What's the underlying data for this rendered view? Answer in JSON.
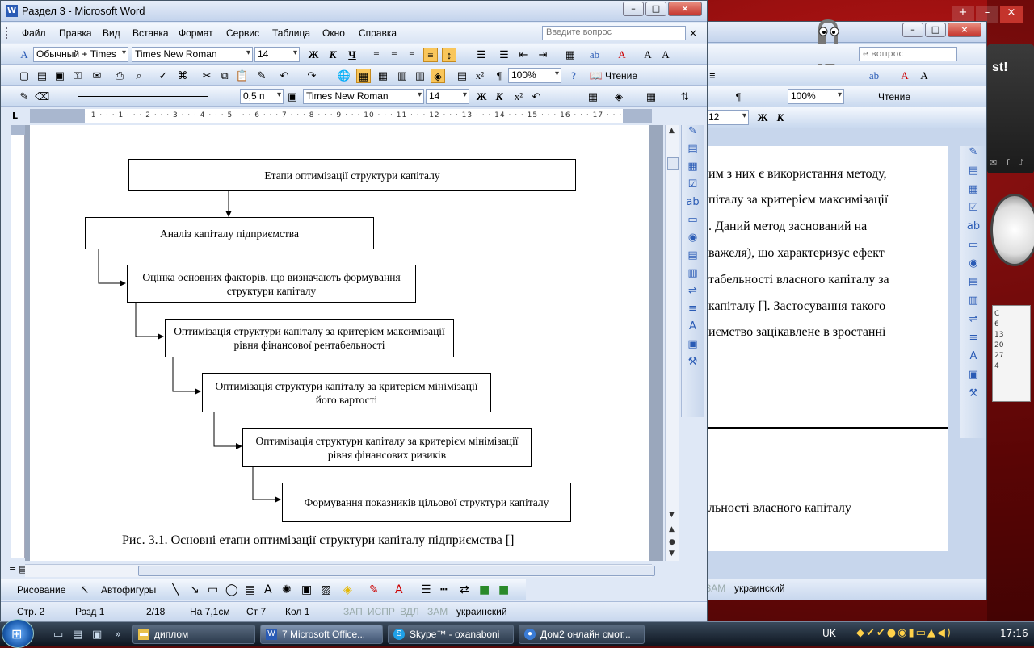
{
  "front_window": {
    "title": "Раздел 3 - Microsoft Word",
    "menu": [
      "Файл",
      "Правка",
      "Вид",
      "Вставка",
      "Формат",
      "Сервис",
      "Таблица",
      "Окно",
      "Справка"
    ],
    "help_placeholder": "Введите вопрос",
    "toolbar1": {
      "style": "Обычный + Times",
      "font": "Times New Roman",
      "size": "14",
      "bold": "Ж",
      "italic": "К",
      "underline": "Ч"
    },
    "toolbar2": {
      "zoom": "100%",
      "reading": "Чтение",
      "pilcrow": "¶"
    },
    "toolbar3": {
      "line_weight": "0,5 п",
      "font": "Times New Roman",
      "size": "14"
    },
    "ruler_corner": "L",
    "ruler_ticks": "· 1 · · · 1 · · · 2 · · · 3 · · · 4 · · · 5 · · · 6 · · · 7 · · · 8 · · · 9 · · · 10 · · · 11 · · · 12 · · · 13 · · · 14 · · · 15 · · · 16 · · · 17 · · · 18",
    "flowchart": {
      "b1": "Етапи оптимізації структури капіталу",
      "b2": "Аналіз капіталу підприємства",
      "b3": "Оцінка основних факторів, що визначають формування структури капіталу",
      "b4": "Оптимізація структури капіталу за критерієм максимізації рівня фінансової рентабельності",
      "b5": "Оптимізація структури капіталу за критерієм мінімізації його вартості",
      "b6": "Оптимізація структури капіталу за критерієм мінімізації рівня фінансових ризиків",
      "b7": "Формування показників цільової структури капіталу"
    },
    "caption": "Рис. 3.1. Основні етапи оптимізації структури капіталу підприємства []",
    "draw_bar": {
      "draw": "Рисование",
      "autoshapes": "Автофигуры"
    },
    "status": {
      "page": "Стр. 2",
      "section": "Разд 1",
      "pages": "2/18",
      "at": "На 7,1см",
      "line": "Ст 7",
      "col": "Кол 1",
      "rec": "ЗАП",
      "trk": "ИСПР",
      "ext": "ВДЛ",
      "ovr": "ЗАМ",
      "lang": "украинский"
    }
  },
  "back_window": {
    "help_placeholder": "е вопрос",
    "font_size": "12",
    "zoom": "100%",
    "reading": "Чтение",
    "lines": [
      "им з них є використання методу,",
      "піталу за критерієм максимізації",
      ". Даний метод заснований на",
      "важеля), що характеризує ефект",
      "табельності власного капіталу за",
      "капіталу []. Застосування такого",
      "иємство зацікавлене в зростанні"
    ],
    "lower_line": "льності власного капіталу",
    "status_ovr": "ЗАМ",
    "status_lang": "украинский"
  },
  "desktop": {
    "banner": "st!"
  },
  "calendar": [
    "С",
    "6",
    "13",
    "20",
    "27",
    "4"
  ],
  "taskbar": {
    "tasks": [
      "диплом",
      "7 Microsoft Office...",
      "Skype™ - oxanaboni",
      "Дом2 онлайн смот..."
    ],
    "lang": "UK",
    "time": "17:16"
  }
}
